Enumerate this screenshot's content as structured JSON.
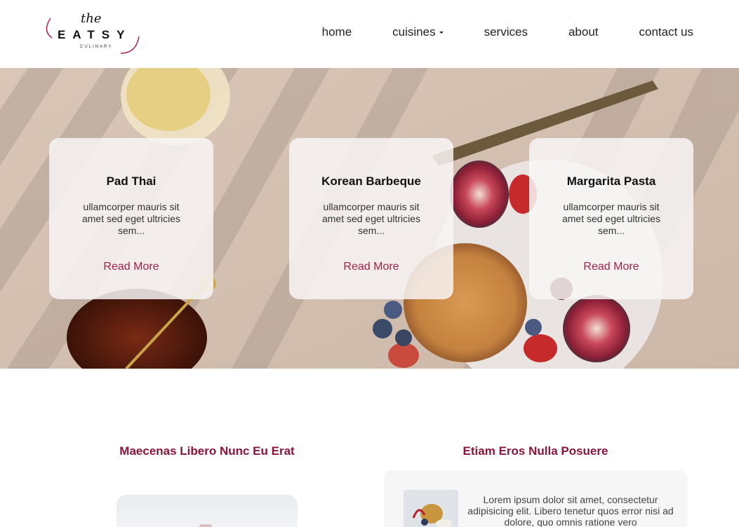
{
  "brand": {
    "script": "the",
    "wordmark": "EATSY",
    "tagline": "CULINARY",
    "accent_color": "#b02454"
  },
  "nav": {
    "items": [
      {
        "label": "home"
      },
      {
        "label": "cuisines",
        "has_dropdown": true
      },
      {
        "label": "services"
      },
      {
        "label": "about"
      },
      {
        "label": "contact us"
      }
    ]
  },
  "hero": {
    "cards": [
      {
        "title": "Pad Thai",
        "text": "ullamcorper mauris sit amet sed eget ultricies sem...",
        "link": "Read More"
      },
      {
        "title": "Korean Barbeque",
        "text": "ullamcorper mauris sit amet sed eget ultricies sem...",
        "link": "Read More"
      },
      {
        "title": "Margarita Pasta",
        "text": "ullamcorper mauris sit amet sed eget ultricies sem...",
        "link": "Read More"
      }
    ]
  },
  "sections": {
    "left_title": "Maecenas Libero Nunc Eu Erat",
    "right_title": "Etiam Eros Nulla Posuere",
    "right_text": "Lorem ipsum dolor sit amet, consectetur adipisicing elit. Libero tenetur quos error nisi ad dolore, quo omnis ratione vero"
  },
  "colors": {
    "link": "#a0214a",
    "heading": "#8a1538"
  }
}
